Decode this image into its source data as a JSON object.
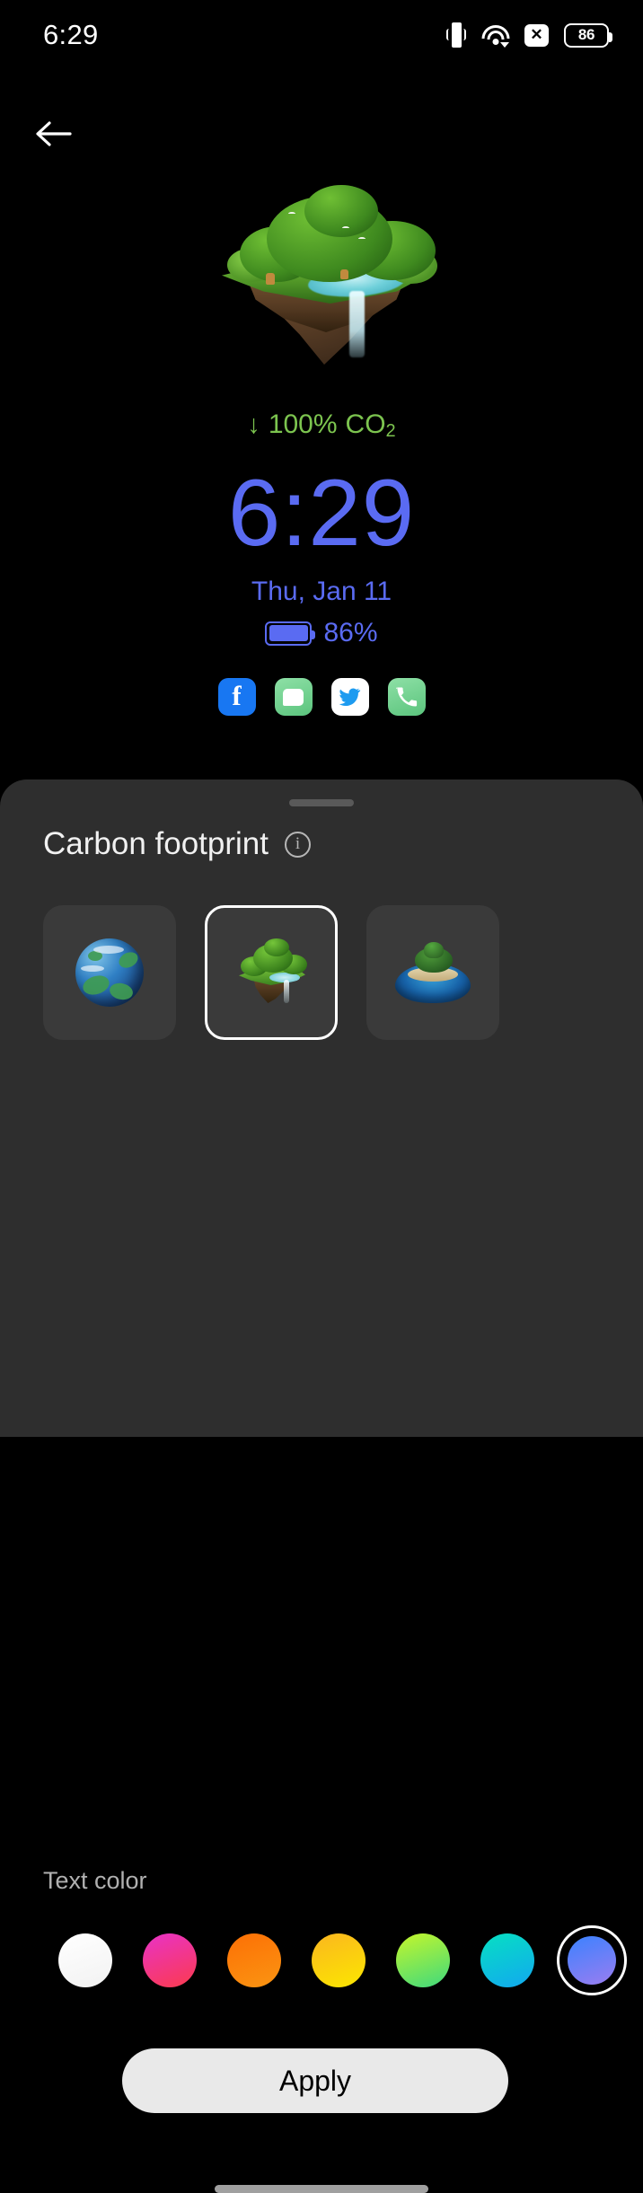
{
  "status_bar": {
    "time": "6:29",
    "icons": [
      {
        "name": "vibrate-icon",
        "label": "vibrate"
      },
      {
        "name": "wifi-icon",
        "label": "wifi"
      },
      {
        "name": "no-sim-icon",
        "label": "x"
      },
      {
        "name": "battery-icon",
        "label": "86"
      }
    ],
    "battery_level": "86"
  },
  "navigation": {
    "back_label": "back"
  },
  "lock_preview": {
    "wallpaper_name": "floating-island",
    "co2": {
      "arrow": "↓",
      "value": "100%",
      "unit": "CO",
      "subscript": "2"
    },
    "clock": "6:29",
    "date": "Thu, Jan 11",
    "battery_text": "86%",
    "accent_color": "#5a6bf2",
    "co2_color": "#7cc44f",
    "shortcuts": [
      {
        "name": "facebook-shortcut",
        "label": "f"
      },
      {
        "name": "messages-shortcut",
        "label": "Messages"
      },
      {
        "name": "twitter-shortcut",
        "label": "Twitter"
      },
      {
        "name": "phone-shortcut",
        "label": "Phone"
      }
    ]
  },
  "sheet": {
    "title": "Carbon footprint",
    "info_label": "i",
    "wallpapers": [
      {
        "name": "earth-globe",
        "selected": false
      },
      {
        "name": "floating-island",
        "selected": true
      },
      {
        "name": "water-island",
        "selected": false
      }
    ],
    "text_color_label": "Text color",
    "swatches": [
      {
        "name": "white",
        "color": "#ffffff",
        "gradient": "linear-gradient(160deg,#ffffff,#f2f2f2)",
        "selected": false
      },
      {
        "name": "pink-red",
        "color": "#f0279a",
        "gradient": "linear-gradient(160deg,#e932c8,#fb3b4e)",
        "selected": false
      },
      {
        "name": "orange",
        "color": "#fb7a0b",
        "gradient": "linear-gradient(160deg,#fc6f05,#fb9512)",
        "selected": false
      },
      {
        "name": "amber-yellow",
        "color": "#fbc021",
        "gradient": "linear-gradient(160deg,#fbb61f,#fbe700)",
        "selected": false
      },
      {
        "name": "lime-green",
        "color": "#8ae22f",
        "gradient": "linear-gradient(160deg,#c6f62a,#3ed97e)",
        "selected": false
      },
      {
        "name": "cyan-blue",
        "color": "#0ad3cf",
        "gradient": "linear-gradient(160deg,#06e0c2,#12a8f0)",
        "selected": false
      },
      {
        "name": "blue-purple",
        "color": "#4f7cfa",
        "gradient": "linear-gradient(160deg,#3b82ff,#9a7df0)",
        "selected": true
      }
    ],
    "apply_label": "Apply"
  }
}
